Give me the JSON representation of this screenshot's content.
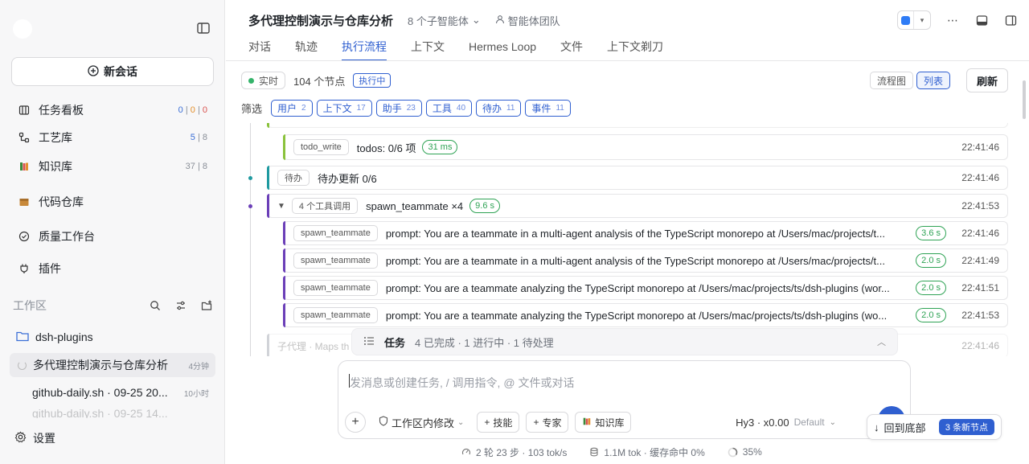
{
  "sidebar": {
    "new_chat": "新会话",
    "nav": [
      {
        "label": "任务看板",
        "icon": "kanban-icon",
        "counts": [
          "0",
          "0",
          "0"
        ]
      },
      {
        "label": "工艺库",
        "icon": "workflow-icon",
        "counts": [
          "5",
          "8"
        ]
      },
      {
        "label": "知识库",
        "icon": "books-icon",
        "counts": [
          "37",
          "8"
        ]
      },
      {
        "label": "代码仓库",
        "icon": "package-icon"
      },
      {
        "label": "质量工作台",
        "icon": "check-circle-icon"
      },
      {
        "label": "插件",
        "icon": "plugin-icon"
      }
    ],
    "workspace_label": "工作区",
    "folder": "dsh-plugins",
    "sessions": [
      {
        "title": "多代理控制演示与仓库分析",
        "time": "4分钟"
      },
      {
        "title": "github-daily.sh · 09-25 20...",
        "time": "10小时"
      },
      {
        "title": "github-daily.sh · 09-25 14...",
        "time": ""
      }
    ],
    "settings": "设置"
  },
  "header": {
    "title": "多代理控制演示与仓库分析",
    "sub_agents": "8 个子智能体",
    "team": "智能体团队"
  },
  "tabs": [
    "对话",
    "轨迹",
    "执行流程",
    "上下文",
    "Hermes Loop",
    "文件",
    "上下文剃刀"
  ],
  "toolbar": {
    "live": "实时",
    "nodes": "104 个节点",
    "status": "执行中",
    "view_flow": "流程图",
    "view_list": "列表",
    "refresh": "刷新"
  },
  "filters": {
    "label": "筛选",
    "chips": [
      {
        "label": "用户",
        "count": "2"
      },
      {
        "label": "上下文",
        "count": "17"
      },
      {
        "label": "助手",
        "count": "23"
      },
      {
        "label": "工具",
        "count": "40"
      },
      {
        "label": "待办",
        "count": "11"
      },
      {
        "label": "事件",
        "count": "11"
      }
    ]
  },
  "flow": {
    "rows": [
      {
        "tag": "todo_write",
        "text": "todos: 0/6 项",
        "dur": "31 ms",
        "ts": "22:41:46"
      },
      {
        "tag": "待办",
        "text": "待办更新 0/6",
        "ts": "22:41:46"
      },
      {
        "tag": "4 个工具调用",
        "text": "spawn_teammate ×4",
        "dur": "9.6 s",
        "ts": "22:41:53"
      },
      {
        "tag": "spawn_teammate",
        "text": "prompt: You are a teammate in a multi-agent analysis of the TypeScript monorepo at /Users/mac/projects/t...",
        "dur": "3.6 s",
        "ts": "22:41:46"
      },
      {
        "tag": "spawn_teammate",
        "text": "prompt: You are a teammate in a multi-agent analysis of the TypeScript monorepo at /Users/mac/projects/t...",
        "dur": "2.0 s",
        "ts": "22:41:49"
      },
      {
        "tag": "spawn_teammate",
        "text": "prompt: You are a teammate analyzing the TypeScript monorepo at /Users/mac/projects/ts/dsh-plugins (wor...",
        "dur": "2.0 s",
        "ts": "22:41:51"
      },
      {
        "tag": "spawn_teammate",
        "text": "prompt: You are a teammate analyzing the TypeScript monorepo at /Users/mac/projects/ts/dsh-plugins (wo...",
        "dur": "2.0 s",
        "ts": "22:41:53"
      },
      {
        "tag": "子代理 · Maps th",
        "ts": "22:41:46"
      }
    ]
  },
  "tasks": {
    "label": "任务",
    "summary": "4 已完成 · 1 进行中 · 1 待处理"
  },
  "composer": {
    "placeholder": "发消息或创建任务, / 调用指令, @ 文件或对话",
    "workspace_mode": "工作区内修改",
    "skills": "技能",
    "experts": "专家",
    "kb": "知识库",
    "model": "Hy3 · x0.00",
    "model_default": "Default"
  },
  "jump": {
    "label": "回到底部",
    "new_nodes": "3 条新节点"
  },
  "status": {
    "steps": "2 轮 23 步 · 103 tok/s",
    "tokens": "1.1M tok · 缓存命中 0%",
    "progress": "35%"
  },
  "colors": {
    "accent": "#2f5fd0",
    "teal": "#1f9aa0",
    "purple": "#6b3fb8",
    "green": "#2fa355",
    "lime": "#8ac23c"
  }
}
